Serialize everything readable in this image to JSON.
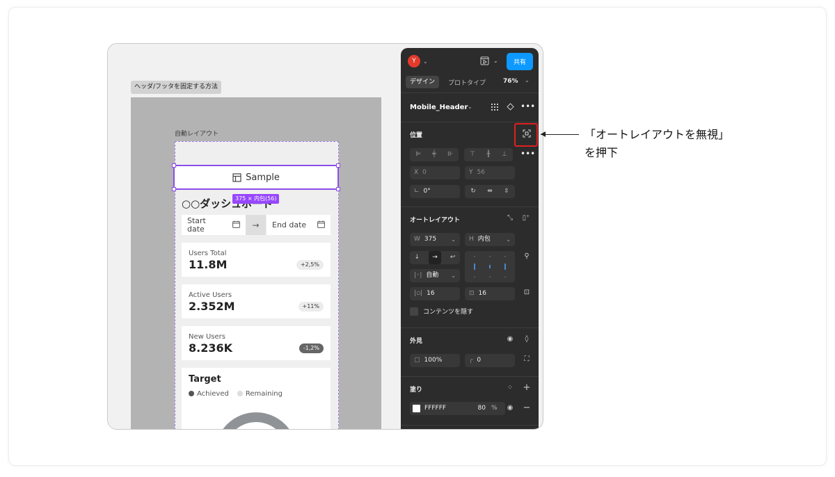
{
  "canvas": {
    "frame_tag": "ヘッダ/フッタを固定する方法",
    "auto_layout_label": "自動レイアウト",
    "header_label": "Sample",
    "size_pill": "375 × 内包(56)",
    "dashboard_title": "○○ダッシュボード",
    "date_start": "Start date",
    "date_end": "End date",
    "stats": [
      {
        "label": "Users Total",
        "value": "11.8M",
        "badge": "+2,5%"
      },
      {
        "label": "Active Users",
        "value": "2.352M",
        "badge": "+11%"
      },
      {
        "label": "New Users",
        "value": "8.236K",
        "badge": "-1,2%"
      }
    ],
    "target_title": "Target",
    "legend_achieved": "Achieved",
    "legend_remaining": "Remaining"
  },
  "panel": {
    "avatar_letter": "Y",
    "share_label": "共有",
    "tab_design": "デザイン",
    "tab_prototype": "プロトタイプ",
    "zoom": "76%",
    "layer_name": "Mobile_Header",
    "section_position": "位置",
    "x_label": "X",
    "x_value": "0",
    "y_label": "Y",
    "y_value": "56",
    "rotation": "0°",
    "section_auto_layout": "オートレイアウト",
    "w_label": "W",
    "w_value": "375",
    "h_label": "H",
    "h_value": "内包",
    "spacing_mode": "自動",
    "gap_value": "16",
    "padding_value": "16",
    "clip_content": "コンテンツを隠す",
    "section_appearance": "外見",
    "opacity": "100%",
    "radius": "0",
    "section_fill": "塗り",
    "fill_hex": "FFFFFF",
    "fill_opacity": "80",
    "fill_unit": "%"
  },
  "callout": {
    "line1": "「オートレイアウトを無視」",
    "line2": "を押下"
  }
}
